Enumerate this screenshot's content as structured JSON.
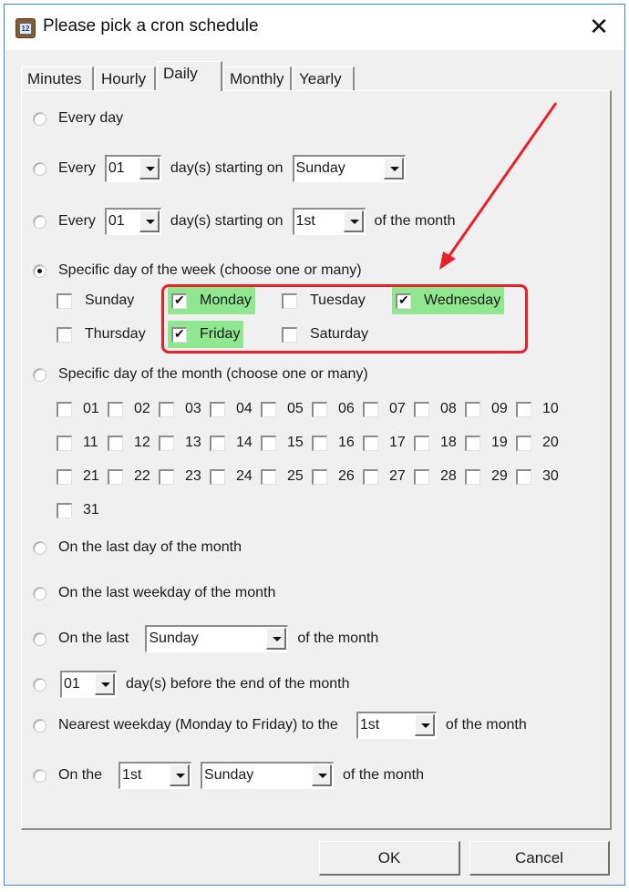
{
  "window": {
    "title": "Please pick a cron schedule",
    "app_icon_text": "12",
    "close_symbol": "✕"
  },
  "tabs": [
    {
      "label": "Minutes",
      "active": false
    },
    {
      "label": "Hourly",
      "active": false
    },
    {
      "label": "Daily",
      "active": true
    },
    {
      "label": "Monthly",
      "active": false
    },
    {
      "label": "Yearly",
      "active": false
    }
  ],
  "options": {
    "every_day": {
      "label": "Every day",
      "selected": false
    },
    "every_n_days_weekday": {
      "prefix": "Every",
      "interval": "01",
      "middle": "day(s) starting on",
      "start": "Sunday",
      "selected": false
    },
    "every_n_days_monthday": {
      "prefix": "Every",
      "interval": "01",
      "middle": "day(s) starting on",
      "start": "1st",
      "suffix": "of the month",
      "selected": false
    },
    "specific_weekday": {
      "label": "Specific day of the week (choose one or many)",
      "selected": true,
      "days": [
        {
          "label": "Sunday",
          "checked": false,
          "highlighted": false
        },
        {
          "label": "Monday",
          "checked": true,
          "highlighted": true
        },
        {
          "label": "Tuesday",
          "checked": false,
          "highlighted": false
        },
        {
          "label": "Wednesday",
          "checked": true,
          "highlighted": true
        },
        {
          "label": "Thursday",
          "checked": false,
          "highlighted": false
        },
        {
          "label": "Friday",
          "checked": true,
          "highlighted": true
        },
        {
          "label": "Saturday",
          "checked": false,
          "highlighted": false
        }
      ]
    },
    "specific_monthday": {
      "label": "Specific day of the month (choose one or many)",
      "selected": false,
      "days": [
        "01",
        "02",
        "03",
        "04",
        "05",
        "06",
        "07",
        "08",
        "09",
        "10",
        "11",
        "12",
        "13",
        "14",
        "15",
        "16",
        "17",
        "18",
        "19",
        "20",
        "21",
        "22",
        "23",
        "24",
        "25",
        "26",
        "27",
        "28",
        "29",
        "30",
        "31"
      ]
    },
    "last_day": {
      "label": "On the last day of the month",
      "selected": false
    },
    "last_weekday": {
      "label": "On the last weekday of the month",
      "selected": false
    },
    "last_named_day": {
      "prefix": "On the last",
      "day": "Sunday",
      "suffix": "of the month",
      "selected": false
    },
    "days_before_end": {
      "count": "01",
      "suffix": "day(s) before the end of the month",
      "selected": false
    },
    "nearest_weekday": {
      "prefix": "Nearest weekday (Monday to Friday) to the",
      "day": "1st",
      "suffix": "of the month",
      "selected": false
    },
    "nth_day": {
      "prefix": "On the",
      "nth": "1st",
      "day": "Sunday",
      "suffix": "of the month",
      "selected": false
    }
  },
  "buttons": {
    "ok": "OK",
    "cancel": "Cancel"
  },
  "annotation": {
    "box_color": "#e8202a",
    "highlight_color": "#8fe88f"
  }
}
